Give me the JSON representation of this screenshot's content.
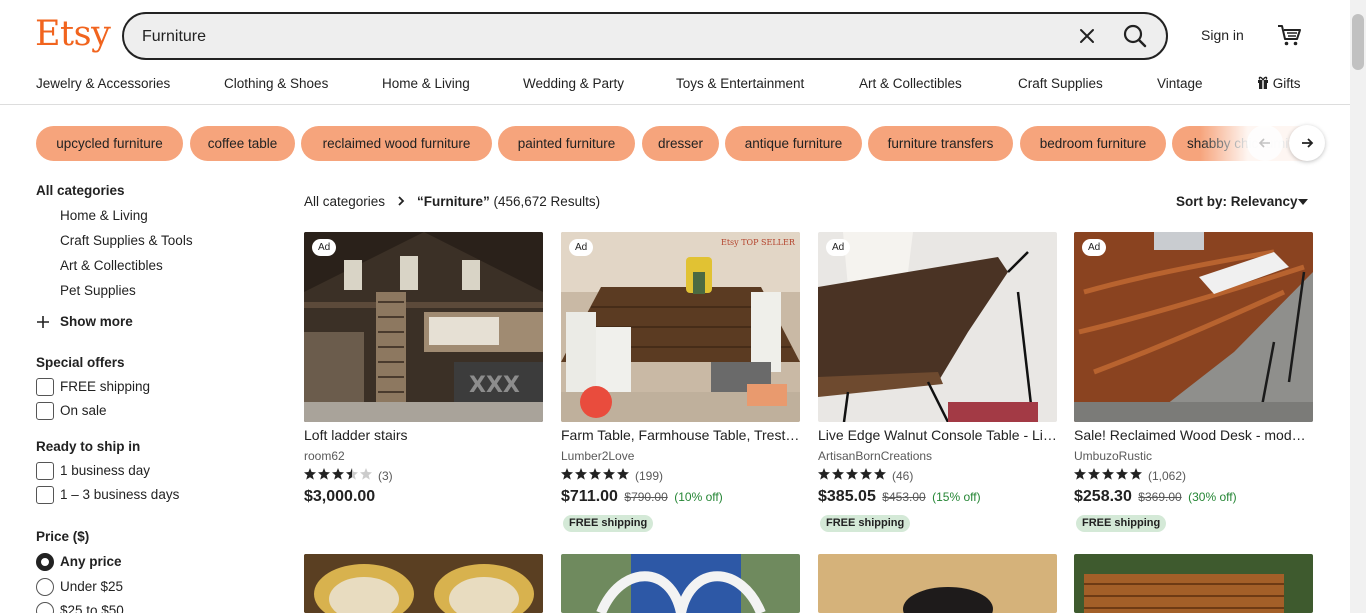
{
  "header": {
    "logo": "Etsy",
    "search_value": "Furniture",
    "sign_in": "Sign in",
    "brand_color": "#f1641e"
  },
  "nav": {
    "categories": [
      "Jewelry & Accessories",
      "Clothing & Shoes",
      "Home & Living",
      "Wedding & Party",
      "Toys & Entertainment",
      "Art & Collectibles",
      "Craft Supplies",
      "Vintage",
      "Gifts"
    ],
    "gifts_icon": "gift-icon"
  },
  "chips": [
    "upcycled furniture",
    "coffee table",
    "reclaimed wood furniture",
    "painted furniture",
    "dresser",
    "antique furniture",
    "furniture transfers",
    "bedroom furniture",
    "shabby chic furniture"
  ],
  "chip_color": "#f6a47c",
  "sidebar": {
    "all_categories": "All categories",
    "category_links": [
      "Home & Living",
      "Craft Supplies & Tools",
      "Art & Collectibles",
      "Pet Supplies"
    ],
    "show_more": "Show more",
    "special_offers": {
      "heading": "Special offers",
      "options": [
        "FREE shipping",
        "On sale"
      ]
    },
    "ready_to_ship": {
      "heading": "Ready to ship in",
      "options": [
        "1 business day",
        "1 – 3 business days"
      ]
    },
    "price": {
      "heading": "Price ($)",
      "options": [
        "Any price",
        "Under $25",
        "$25 to $50"
      ],
      "selected": "Any price"
    }
  },
  "results": {
    "breadcrumb_root": "All categories",
    "query": "“Furniture”",
    "count": "(456,672 Results)",
    "sort_label": "Sort by: Relevancy"
  },
  "listings": [
    {
      "ad": "Ad",
      "title": "Loft ladder stairs",
      "shop": "room62",
      "rating": 3.5,
      "reviews": "(3)",
      "price": "$3,000.00",
      "original": "",
      "discount": "",
      "shipping": ""
    },
    {
      "ad": "Ad",
      "title": "Farm Table, Farmhouse Table, Trestle Table",
      "shop": "Lumber2Love",
      "rating": 5,
      "reviews": "(199)",
      "price": "$711.00",
      "original": "$790.00",
      "discount": "(10% off)",
      "shipping": "FREE shipping",
      "image_text": "Etsy TOP SELLER"
    },
    {
      "ad": "Ad",
      "title": "Live Edge Walnut Console Table - Live Edge",
      "shop": "ArtisanBornCreations",
      "rating": 5,
      "reviews": "(46)",
      "price": "$385.05",
      "original": "$453.00",
      "discount": "(15% off)",
      "shipping": "FREE shipping"
    },
    {
      "ad": "Ad",
      "title": "Sale! Reclaimed Wood Desk - modern live edge",
      "shop": "UmbuzoRustic",
      "rating": 5,
      "reviews": "(1,062)",
      "price": "$258.30",
      "original": "$369.00",
      "discount": "(30% off)",
      "shipping": "FREE shipping"
    }
  ]
}
